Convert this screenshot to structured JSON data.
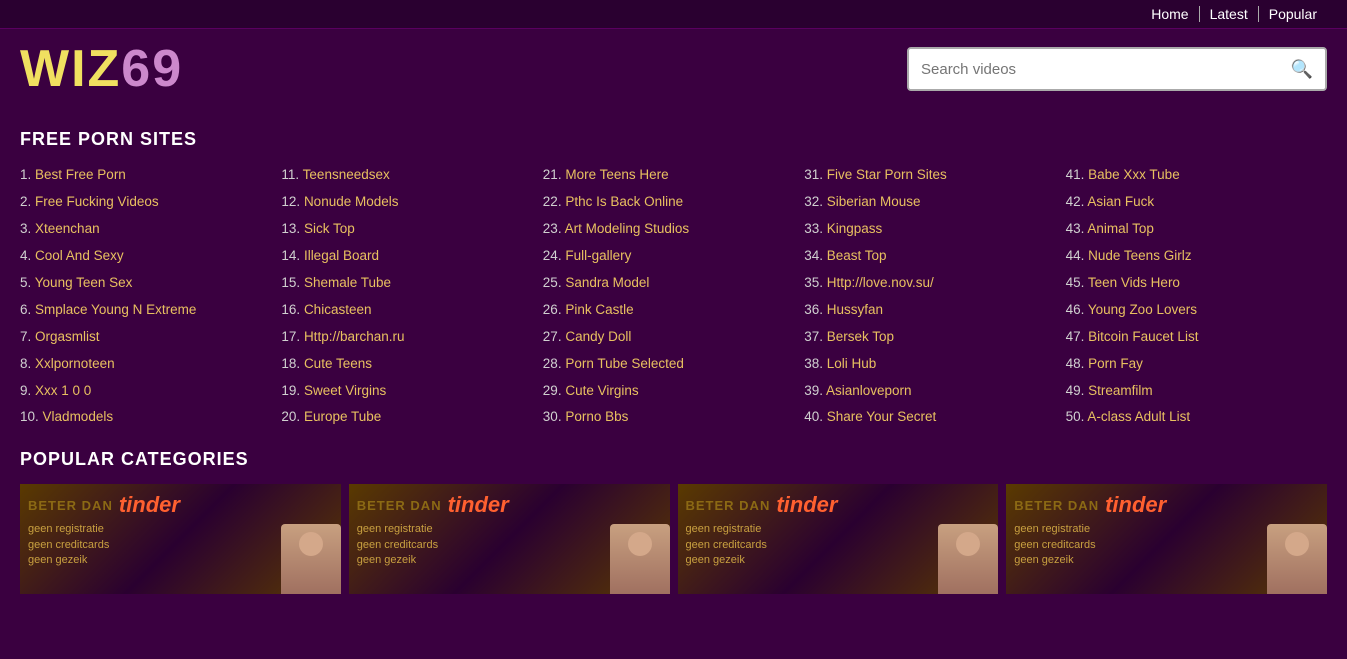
{
  "nav": {
    "items": [
      {
        "label": "Home",
        "href": "#"
      },
      {
        "label": "Latest",
        "href": "#"
      },
      {
        "label": "Popular",
        "href": "#"
      }
    ]
  },
  "header": {
    "logo_text1": "WIZ",
    "logo_text2": "69",
    "search_placeholder": "Search videos"
  },
  "free_porn_sites": {
    "section_title": "FREE PORN SITES",
    "columns": [
      [
        {
          "num": "1.",
          "label": "Best Free Porn"
        },
        {
          "num": "2.",
          "label": "Free Fucking Videos"
        },
        {
          "num": "3.",
          "label": "Xteenchan"
        },
        {
          "num": "4.",
          "label": "Cool And Sexy"
        },
        {
          "num": "5.",
          "label": "Young Teen Sex"
        },
        {
          "num": "6.",
          "label": "Smplace Young N Extreme"
        },
        {
          "num": "7.",
          "label": "Orgasmlist"
        },
        {
          "num": "8.",
          "label": "Xxlpornoteen"
        },
        {
          "num": "9.",
          "label": "Xxx 1 0 0"
        },
        {
          "num": "10.",
          "label": "Vladmodels"
        }
      ],
      [
        {
          "num": "11.",
          "label": "Teensneedsex"
        },
        {
          "num": "12.",
          "label": "Nonude Models"
        },
        {
          "num": "13.",
          "label": "Sick Top"
        },
        {
          "num": "14.",
          "label": "Illegal Board"
        },
        {
          "num": "15.",
          "label": "Shemale Tube"
        },
        {
          "num": "16.",
          "label": "Chicasteen"
        },
        {
          "num": "17.",
          "label": "Http://barchan.ru"
        },
        {
          "num": "18.",
          "label": "Cute Teens"
        },
        {
          "num": "19.",
          "label": "Sweet Virgins"
        },
        {
          "num": "20.",
          "label": "Europe Tube"
        }
      ],
      [
        {
          "num": "21.",
          "label": "More Teens Here"
        },
        {
          "num": "22.",
          "label": "Pthc Is Back Online"
        },
        {
          "num": "23.",
          "label": "Art Modeling Studios"
        },
        {
          "num": "24.",
          "label": "Full-gallery"
        },
        {
          "num": "25.",
          "label": "Sandra Model"
        },
        {
          "num": "26.",
          "label": "Pink Castle"
        },
        {
          "num": "27.",
          "label": "Candy Doll"
        },
        {
          "num": "28.",
          "label": "Porn Tube Selected"
        },
        {
          "num": "29.",
          "label": "Cute Virgins"
        },
        {
          "num": "30.",
          "label": "Porno Bbs"
        }
      ],
      [
        {
          "num": "31.",
          "label": "Five Star Porn Sites"
        },
        {
          "num": "32.",
          "label": "Siberian Mouse"
        },
        {
          "num": "33.",
          "label": "Kingpass"
        },
        {
          "num": "34.",
          "label": "Beast Top"
        },
        {
          "num": "35.",
          "label": "Http://love.nov.su/"
        },
        {
          "num": "36.",
          "label": "Hussyfan"
        },
        {
          "num": "37.",
          "label": "Bersek Top"
        },
        {
          "num": "38.",
          "label": "Loli Hub"
        },
        {
          "num": "39.",
          "label": "Asianloveporn"
        },
        {
          "num": "40.",
          "label": "Share Your Secret"
        }
      ],
      [
        {
          "num": "41.",
          "label": "Babe Xxx Tube"
        },
        {
          "num": "42.",
          "label": "Asian Fuck"
        },
        {
          "num": "43.",
          "label": "Animal Top"
        },
        {
          "num": "44.",
          "label": "Nude Teens Girlz"
        },
        {
          "num": "45.",
          "label": "Teen Vids Hero"
        },
        {
          "num": "46.",
          "label": "Young Zoo Lovers"
        },
        {
          "num": "47.",
          "label": "Bitcoin Faucet List"
        },
        {
          "num": "48.",
          "label": "Porn Fay"
        },
        {
          "num": "49.",
          "label": "Streamfilm"
        },
        {
          "num": "50.",
          "label": "A-class Adult List"
        }
      ]
    ]
  },
  "popular_categories": {
    "section_title": "POPULAR CATEGORIES",
    "ads": [
      {
        "beter_dan": "BETER DAN",
        "tinder": "tinder",
        "line1": "geen registratie",
        "line2": "geen creditcards",
        "line3": "geen gezeik"
      },
      {
        "beter_dan": "BETER DAN",
        "tinder": "tinder",
        "line1": "geen registratie",
        "line2": "geen creditcards",
        "line3": "geen gezeik"
      },
      {
        "beter_dan": "BETER DAN",
        "tinder": "tinder",
        "line1": "geen registratie",
        "line2": "geen creditcards",
        "line3": "geen gezeik"
      },
      {
        "beter_dan": "BETER DAN",
        "tinder": "tinder",
        "line1": "geen registratie",
        "line2": "geen creditcards",
        "line3": "geen gezeik"
      }
    ]
  },
  "icons": {
    "search": "🔍"
  }
}
